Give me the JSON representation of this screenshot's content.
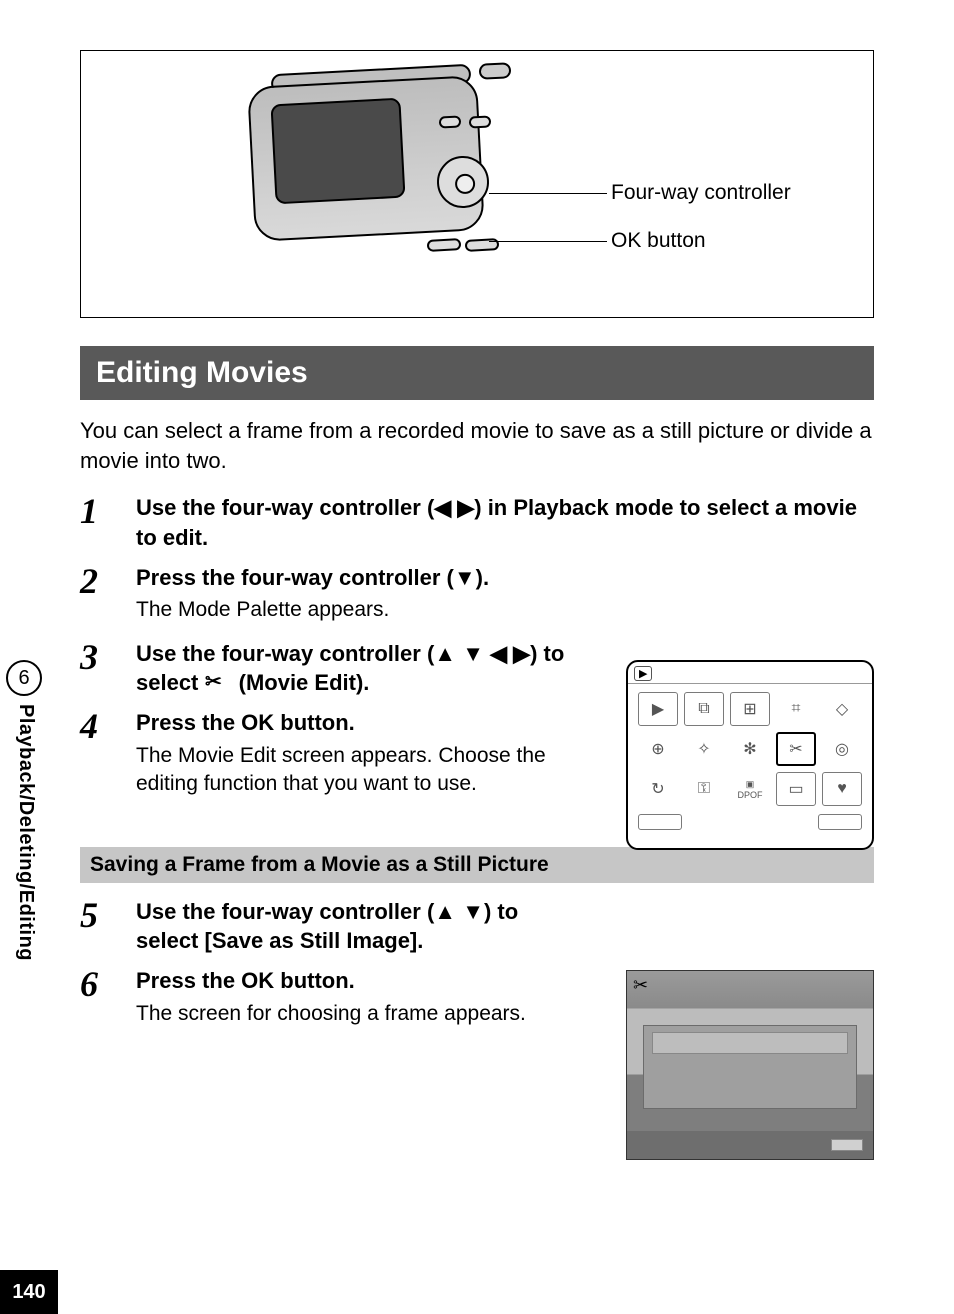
{
  "figure": {
    "label_fourway": "Four-way controller",
    "label_ok": "OK button"
  },
  "section_title": "Editing Movies",
  "intro": "You can select a frame from a recorded movie to save as a still picture or divide a movie into two.",
  "steps": {
    "s1": {
      "num": "1",
      "title_a": "Use the four-way controller (",
      "title_b": ") in Playback mode to select a movie to edit."
    },
    "s2": {
      "num": "2",
      "title_a": "Press the four-way controller (",
      "title_b": ").",
      "text": "The Mode Palette appears."
    },
    "s3": {
      "num": "3",
      "title_a": "Use the four-way controller (",
      "title_b": ") to select ",
      "title_c": " (Movie Edit)."
    },
    "s4": {
      "num": "4",
      "title": "Press the OK button.",
      "text": "The Movie Edit screen appears. Choose the editing function that you want to use."
    },
    "s5": {
      "num": "5",
      "title_a": "Use the four-way controller (",
      "title_b": ") to select [Save as Still Image]."
    },
    "s6": {
      "num": "6",
      "title": "Press the OK button.",
      "text": "The screen for choosing a frame appears."
    }
  },
  "subheading": "Saving a Frame from a Movie as a Still Picture",
  "side": {
    "chapter": "6",
    "label": "Playback/Deleting/Editing"
  },
  "page_number": "140",
  "icons": {
    "left": "◀",
    "right": "▶",
    "up": "▲",
    "down": "▼",
    "scissors": "✂",
    "playback": "▶"
  },
  "palette_icons": [
    "▶",
    "⧉",
    "⊞",
    "⌗",
    "◇",
    "⊕",
    "✧",
    "✻",
    "✂",
    "◎",
    "↻",
    "⚿",
    "▣",
    "▭",
    "♥"
  ],
  "palette_dpof": "DPOF"
}
